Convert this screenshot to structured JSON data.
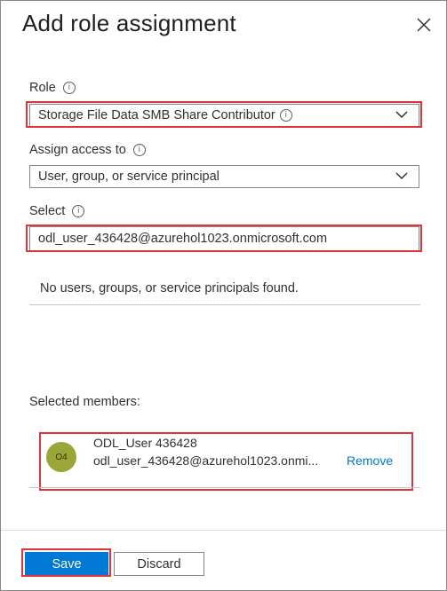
{
  "panel": {
    "title": "Add role assignment"
  },
  "role": {
    "label": "Role",
    "value": "Storage File Data SMB Share Contributor"
  },
  "assign_access": {
    "label": "Assign access to",
    "value": "User, group, or service principal"
  },
  "select": {
    "label": "Select",
    "value": "odl_user_436428@azurehol1023.onmicrosoft.com"
  },
  "results": {
    "empty_message": "No users, groups, or service principals found."
  },
  "selected_members": {
    "label": "Selected members:",
    "items": [
      {
        "initials": "O4",
        "name": "ODL_User 436428",
        "email": "odl_user_436428@azurehol1023.onmi...",
        "remove_label": "Remove"
      }
    ]
  },
  "footer": {
    "save_label": "Save",
    "discard_label": "Discard"
  },
  "icons": {
    "info": "i",
    "close": "close-icon",
    "chevron": "chevron-down-icon"
  },
  "colors": {
    "accent": "#0078d4",
    "highlight": "#e0343d",
    "avatar": "#9aa637"
  }
}
